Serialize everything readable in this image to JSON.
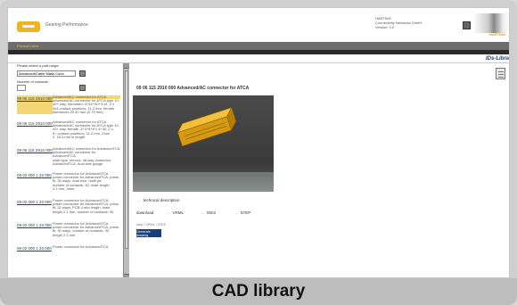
{
  "header": {
    "logo_text": "Gearing Performance",
    "company_lines": [
      "HARTING",
      "Connectivity Networks GmbH",
      "Version: 2.0"
    ],
    "brand": "HARTING"
  },
  "nav": {
    "link": "Product Links"
  },
  "rightbar": {
    "title": "IDs-Libra"
  },
  "left": {
    "select_label": "Please select a part range:",
    "select_value": "Advanced/Cable Mass Conn",
    "num_label": "Number of contacts:",
    "results": [
      {
        "pn": "09 06 115 2910 000",
        "desc": [
          "Advanced/AC connector for ATCA",
          "advanced/AC connector for ATCA type 10, 40+ way, shrouded, 4+40+40+4 x4, 2 x 4x4 contact positions, 11.2 mm, female",
          "tolerances 20 50 mm (0.79 mm)"
        ],
        "hl": true
      },
      {
        "pn": "09 06 115 2910 000",
        "desc": [
          "Advanced/AC connector for ATCA",
          "advanced/AC connector for ATCA type 10,",
          "40+ way, female, 3+3+5+8 x 4+40, 2 x",
          "5+ contact positions, 11.2 mm, Zone",
          "2, 15.4 mm in length"
        ]
      },
      {
        "pn": "09 06 115 2910 000",
        "desc": [
          "Advanced/AC connector for AdvancedTCA",
          "advanced/AC connector for AdvancedTCA,",
          "wide type, shroud, 48-way connector,",
          "AdvancedTCA, dual wire gauge"
        ]
      },
      {
        "pn": "09 02 000 1 20 000",
        "desc": [
          "Power connector for AdvancedTCA",
          "power connector for AdvancedTCA, press",
          "fit, 30 ways, dual wire, multi pin",
          "number of contacts: 30, male length",
          "2.1 mm, 4mm"
        ]
      },
      {
        "pn": "09 02 000 1 20 000",
        "desc": [
          "Power connector for AdvancedTCA",
          "power connector for AdvancedTCA, press",
          "fit, 32 ways, PCB 4 mm length, male",
          "length 2.1 mm, number of contacts: 30"
        ]
      },
      {
        "pn": "09 02 000 1 20 000",
        "desc": [
          "Power connector for AdvancedTCA",
          "power connector for AdvancedTCA, press",
          "fit, 30 ways, number of contacts: 30,",
          "length 2.1 mm"
        ]
      },
      {
        "pn": "09 02 000 1 20 000",
        "desc": [
          "Power connector for AdvancedTCA"
        ]
      }
    ]
  },
  "main": {
    "title": "09 06 115 2910 000 Advanced/AC connector for ATCA",
    "tech_desc": "technical description",
    "download_label": "download",
    "formats": [
      "VRML",
      "IGES",
      "STEP"
    ],
    "fmt_note": "step / VRML / IGES",
    "button": "Generate drawing"
  },
  "caption": "CAD library"
}
